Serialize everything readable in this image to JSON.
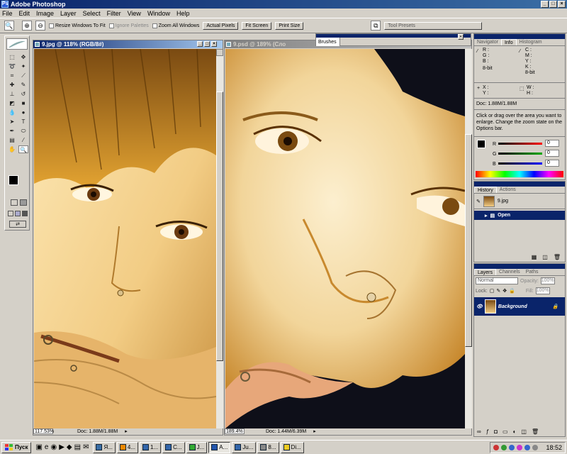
{
  "app": {
    "title": "Adobe Photoshop"
  },
  "menu": [
    "File",
    "Edit",
    "Image",
    "Layer",
    "Select",
    "Filter",
    "View",
    "Window",
    "Help"
  ],
  "options": {
    "resize_windows": "Resize Windows To Fit",
    "ignore_palettes": "Ignore Palettes",
    "zoom_all": "Zoom All Windows",
    "actual_pixels": "Actual Pixels",
    "fit_screen": "Fit Screen",
    "print_size": "Print Size",
    "tool_presets": "Tool Presets"
  },
  "doc1": {
    "title": "9.jpg @ 118% (RGB/8#)",
    "zoom": "117.53%",
    "status": "Doc: 1.88M/1.88M"
  },
  "doc2": {
    "title": "9.psd @ 189% (Сло",
    "zoom": "189.4%",
    "status": "Doc: 1.44M/6.39M"
  },
  "brushes": {
    "title": "Brushes"
  },
  "navigator": {
    "tabs": [
      "Navigator",
      "Info",
      "Histogram"
    ],
    "rgb": [
      "R :",
      "G :",
      "B :"
    ],
    "cmyk": [
      "C :",
      "M :",
      "Y :",
      "K :"
    ],
    "bit_left": "8-bit",
    "bit_right": "8-bit",
    "xy": [
      "X :",
      "Y :"
    ],
    "wh": [
      "W :",
      "H :"
    ],
    "doc": "Doc: 1.88M/1.88M",
    "help": "Click or drag over the area you want to enlarge. Change the zoom state on the Options bar."
  },
  "color": {
    "labels": [
      "R",
      "G",
      "B"
    ],
    "values": [
      "0",
      "0",
      "0"
    ]
  },
  "history": {
    "tabs": [
      "History",
      "Actions"
    ],
    "snapshot": "9.jpg",
    "step": "Open"
  },
  "layers": {
    "tabs": [
      "Layers",
      "Channels",
      "Paths"
    ],
    "blend": "Normal",
    "opacity_label": "Opacity:",
    "opacity": "100%",
    "lock_label": "Lock:",
    "fill_label": "Fill:",
    "fill": "100%",
    "layer_name": "Background"
  },
  "taskbar": {
    "start": "Пуск",
    "buttons": [
      "Я...",
      "4...",
      "1...",
      "С...",
      "J...",
      "А...",
      "Ju...",
      "8...",
      "Di..."
    ],
    "clock": "18:52"
  },
  "colors": {
    "titlebar": "#0a246a",
    "selection": "#0a246a",
    "face_light": "#f2d59a",
    "face_shadow": "#c8892e",
    "dark_bg": "#0e0f19"
  }
}
